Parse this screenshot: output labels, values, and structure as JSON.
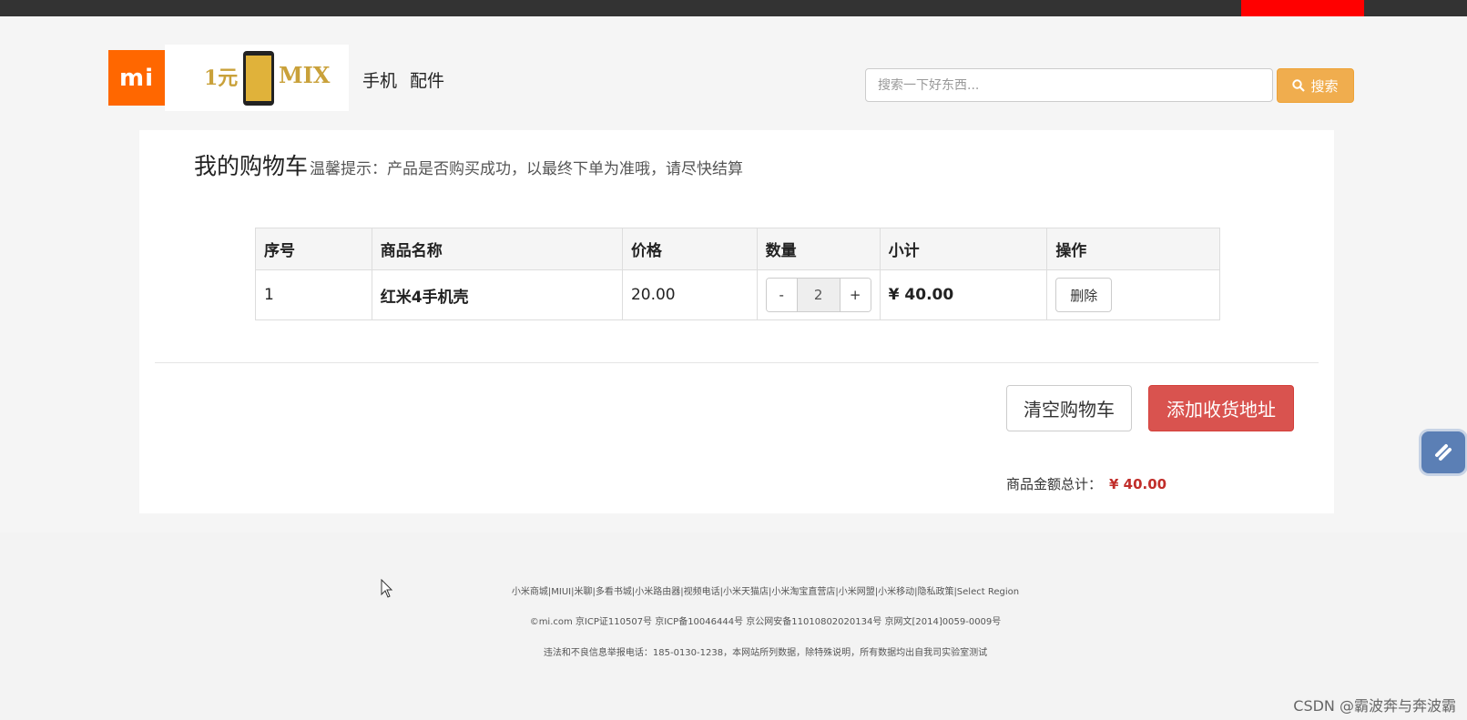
{
  "header": {
    "logo_text": "mi",
    "banner_text": "1元",
    "banner_text2": "MIX",
    "nav": [
      "手机",
      "配件"
    ],
    "search_placeholder": "搜索一下好东西...",
    "search_button": "搜索"
  },
  "cart": {
    "title": "我的购物车",
    "tip": "温馨提示：产品是否购买成功，以最终下单为准哦，请尽快结算",
    "columns": [
      "序号",
      "商品名称",
      "价格",
      "数量",
      "小计",
      "操作"
    ],
    "rows": [
      {
        "index": "1",
        "name": "红米4手机壳",
        "price": "20.00",
        "qty_minus": "-",
        "qty": "2",
        "qty_plus": "+",
        "subtotal": "¥ 40.00",
        "action": "删除"
      }
    ],
    "clear_button": "清空购物车",
    "address_button": "添加收货地址",
    "total_label": "商品金额总计：",
    "total_amount": "¥  40.00"
  },
  "footer": {
    "line1": "小米商城|MIUI|米聊|多看书城|小米路由器|视频电话|小米天猫店|小米淘宝直营店|小米网盟|小米移动|隐私政策|Select Region",
    "line2": "©mi.com 京ICP证110507号 京ICP备10046444号 京公网安备11010802020134号 京网文[2014]0059-0009号",
    "line3": "违法和不良信息举报电话：185-0130-1238，本网站所列数据，除特殊说明，所有数据均出自我司实验室测试"
  },
  "watermark": "CSDN @霸波奔与奔波霸",
  "icons": [
    "search-icon",
    "cursor-icon",
    "side-widget-icon"
  ],
  "colors": {
    "brand": "#ff6700",
    "search_button": "#f0ad4e",
    "danger": "#d9534f",
    "price": "#c12e2a"
  }
}
